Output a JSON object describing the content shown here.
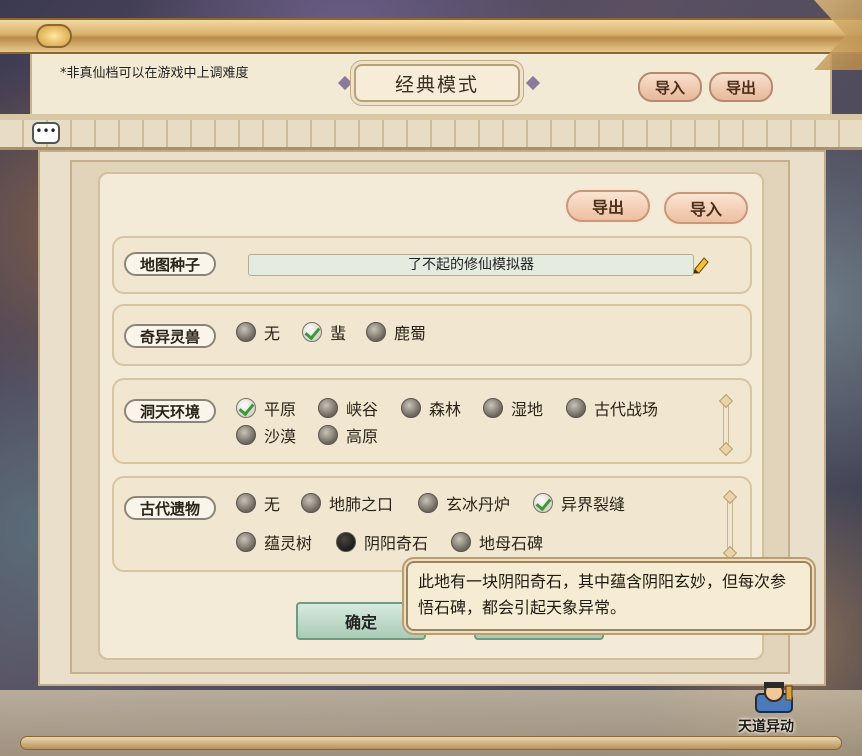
{
  "header": {
    "hint": "*非真仙档可以在游戏中上调难度",
    "mode_title": "经典模式",
    "import_label": "导入",
    "export_label": "导出"
  },
  "card": {
    "export_label": "导出",
    "import_label": "导入"
  },
  "sections": {
    "map_seed": {
      "label": "地图种子",
      "value": "了不起的修仙模拟器"
    },
    "beast": {
      "label": "奇异灵兽",
      "options": [
        "无",
        "蜚",
        "鹿蜀"
      ],
      "checked": "蜚"
    },
    "environment": {
      "label": "洞天环境",
      "options": [
        "平原",
        "峡谷",
        "森林",
        "湿地",
        "古代战场",
        "沙漠",
        "高原"
      ],
      "checked": "平原"
    },
    "relics": {
      "label": "古代遗物",
      "options": [
        "无",
        "地肺之口",
        "玄冰丹炉",
        "异界裂缝",
        "蕴灵树",
        "阴阳奇石",
        "地母石碑"
      ],
      "checked": "异界裂缝",
      "hovered": "阴阳奇石"
    }
  },
  "buttons": {
    "confirm": "确定"
  },
  "tooltip": {
    "text": "此地有一块阴阳奇石，其中蕴含阴阳玄妙，但每次参悟石碑，都会引起天象异常。"
  },
  "corner": {
    "label": "天道异动"
  },
  "icons": {
    "chat": "chat-bubble-icon",
    "edit": "pencil-icon",
    "event": "character-icon"
  }
}
